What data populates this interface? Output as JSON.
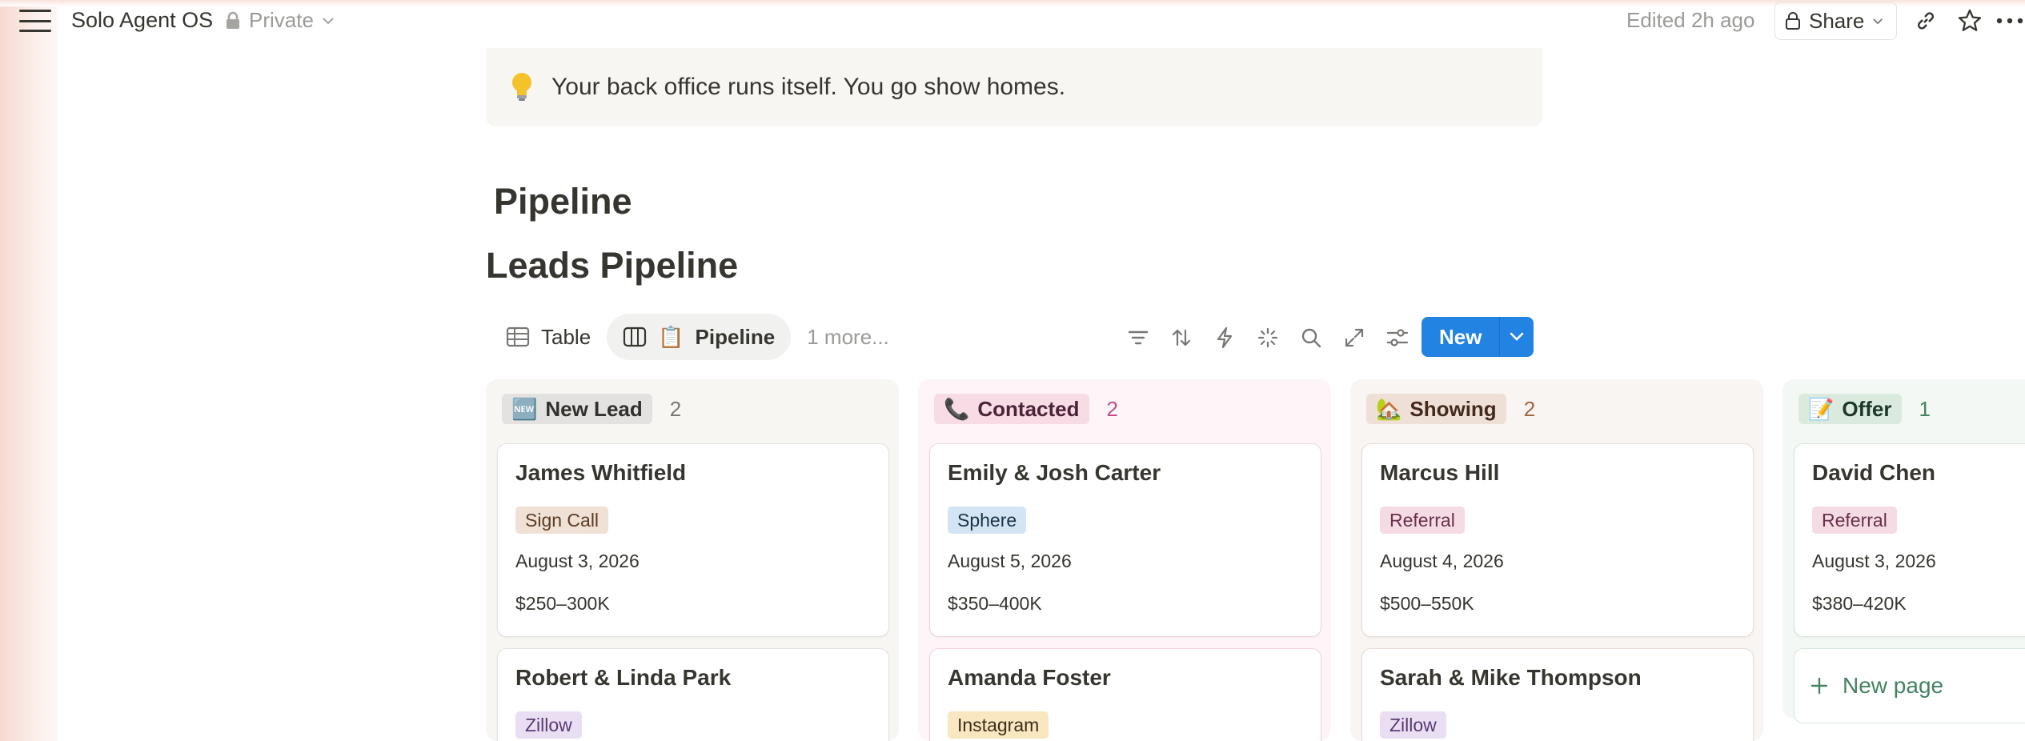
{
  "topbar": {
    "workspace_title": "Solo Agent OS",
    "privacy_label": "Private",
    "edited_label": "Edited 2h ago",
    "share_label": "Share"
  },
  "callout": {
    "icon": "lightbulb-icon",
    "text": "Your back office runs itself. You go show homes."
  },
  "headings": {
    "section": "Pipeline",
    "database": "Leads Pipeline"
  },
  "views": {
    "tabs": [
      {
        "label": "Table",
        "icon": "table-icon",
        "active": false
      },
      {
        "label": "Pipeline",
        "icon": "board-icon",
        "emoji": "📋",
        "active": true
      }
    ],
    "more": "1 more..."
  },
  "toolbar": {
    "icons": [
      "filter-icon",
      "sort-icon",
      "automation-icon",
      "ai-sparkle-icon",
      "search-icon",
      "expand-icon",
      "settings-icon"
    ],
    "new_label": "New"
  },
  "board": {
    "columns": [
      {
        "emoji": "🆕",
        "name": "New Lead",
        "count": "2",
        "bg": "#f7f6f3",
        "tag_bg": "#e3e2e0",
        "tag_color": "#32302c",
        "count_color": "#787774",
        "card_border": "#e3e2e0",
        "cards": [
          {
            "name": "James Whitfield",
            "tag": "Sign Call",
            "tag_bg": "#f0e1d7",
            "tag_color": "#5c3b23",
            "date": "August 3, 2026",
            "price": "$250–300K"
          },
          {
            "name": "Robert & Linda Park",
            "tag": "Zillow",
            "tag_bg": "#eadff2",
            "tag_color": "#5a3a75"
          }
        ]
      },
      {
        "emoji": "📞",
        "name": "Contacted",
        "count": "2",
        "bg": "#fdf5f7",
        "tag_bg": "#f7dbe5",
        "tag_color": "#4c2337",
        "count_color": "#c14c8a",
        "card_border": "#f3d2df",
        "cards": [
          {
            "name": "Emily & Josh Carter",
            "tag": "Sphere",
            "tag_bg": "#d3e5f4",
            "tag_color": "#183347",
            "date": "August 5, 2026",
            "price": "$350–400K"
          },
          {
            "name": "Amanda Foster",
            "tag": "Instagram",
            "tag_bg": "#f8e7bf",
            "tag_color": "#402c1b"
          }
        ]
      },
      {
        "emoji": "🏡",
        "name": "Showing",
        "count": "2",
        "bg": "#f9f5f2",
        "tag_bg": "#eee0d6",
        "tag_color": "#442a1e",
        "count_color": "#a0663e",
        "card_border": "#e7ddd5",
        "cards": [
          {
            "name": "Marcus Hill",
            "tag": "Referral",
            "tag_bg": "#f5dbe3",
            "tag_color": "#69314c",
            "date": "August 4, 2026",
            "price": "$500–550K"
          },
          {
            "name": "Sarah & Mike Thompson",
            "tag": "Zillow",
            "tag_bg": "#eadff2",
            "tag_color": "#5a3a75"
          }
        ]
      },
      {
        "emoji": "📝",
        "name": "Offer",
        "count": "1",
        "bg": "#f4f8f5",
        "tag_bg": "#dbeadf",
        "tag_color": "#1c3829",
        "count_color": "#448361",
        "card_border": "#d6e6db",
        "cards": [
          {
            "name": "David Chen",
            "tag": "Referral",
            "tag_bg": "#f5dbe3",
            "tag_color": "#69314c",
            "date": "August 3, 2026",
            "price": "$380–420K"
          }
        ],
        "new_page_label": "New page"
      }
    ]
  }
}
